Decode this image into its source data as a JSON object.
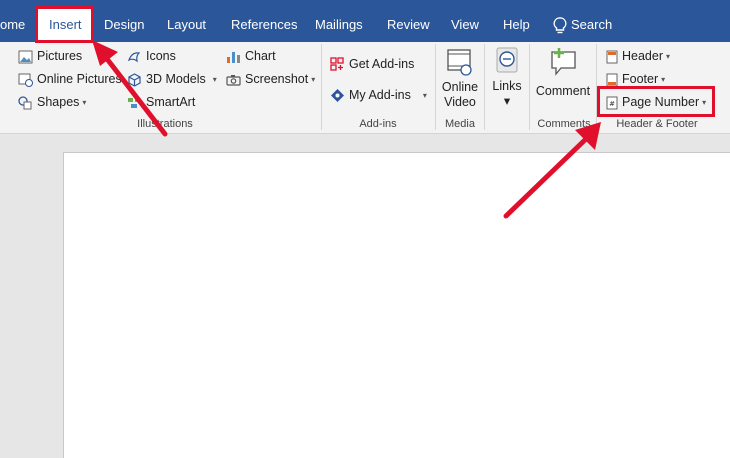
{
  "tabs": [
    {
      "label": "ome",
      "active": false
    },
    {
      "label": "Insert",
      "active": true
    },
    {
      "label": "Design",
      "active": false
    },
    {
      "label": "Layout",
      "active": false
    },
    {
      "label": "References",
      "active": false
    },
    {
      "label": "Mailings",
      "active": false
    },
    {
      "label": "Review",
      "active": false
    },
    {
      "label": "View",
      "active": false
    },
    {
      "label": "Help",
      "active": false
    },
    {
      "label": "Search",
      "active": false
    }
  ],
  "illustrations": {
    "group_label": "Illustrations",
    "pictures": "Pictures",
    "online_pictures": "Online Pictures",
    "shapes": "Shapes",
    "icons": "Icons",
    "models_3d": "3D Models",
    "smartart": "SmartArt",
    "chart": "Chart",
    "screenshot": "Screenshot"
  },
  "addins": {
    "group_label": "Add-ins",
    "get_addins": "Get Add-ins",
    "my_addins": "My Add-ins"
  },
  "media": {
    "group_label": "Media",
    "online_video_line1": "Online",
    "online_video_line2": "Video"
  },
  "links": {
    "label": "Links"
  },
  "comments": {
    "group_label": "Comments",
    "comment": "Comment"
  },
  "header_footer": {
    "group_label": "Header & Footer",
    "header": "Header",
    "footer": "Footer",
    "page_number": "Page Number"
  },
  "colors": {
    "accent": "#2b579a",
    "highlight": "#e0102c"
  }
}
